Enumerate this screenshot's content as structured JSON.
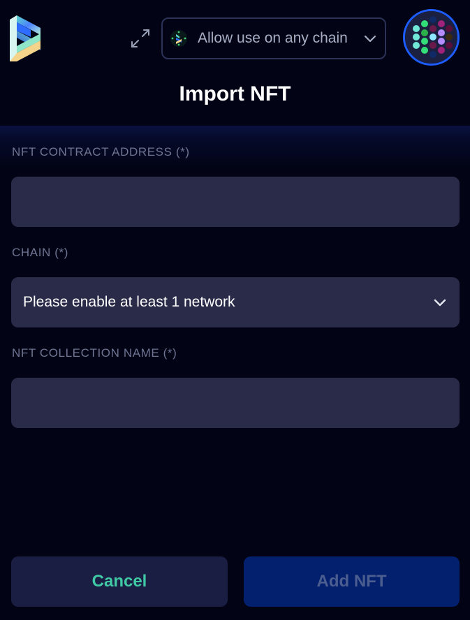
{
  "header": {
    "title": "Import NFT",
    "chain_selector": {
      "label": "Allow use on any chain",
      "icon": "chain-logo-icon",
      "chevron": "chevron-down-icon"
    },
    "expand_icon": "expand-icon",
    "logo": "app-logo",
    "avatar": "account-avatar"
  },
  "form": {
    "contract_address": {
      "label": "NFT CONTRACT ADDRESS (*)",
      "value": "",
      "placeholder": ""
    },
    "chain": {
      "label": "CHAIN (*)",
      "value": "Please enable at least 1 network"
    },
    "collection_name": {
      "label": "NFT COLLECTION NAME (*)",
      "value": "",
      "placeholder": ""
    }
  },
  "footer": {
    "cancel_label": "Cancel",
    "add_label": "Add NFT"
  },
  "colors": {
    "background": "#020416",
    "field": "#292b49",
    "label": "#6f7592",
    "cancel_text": "#3fc9a4",
    "add_bg": "#03206e",
    "add_text": "#4c5d8f",
    "avatar_ring": "#1d5cff"
  }
}
